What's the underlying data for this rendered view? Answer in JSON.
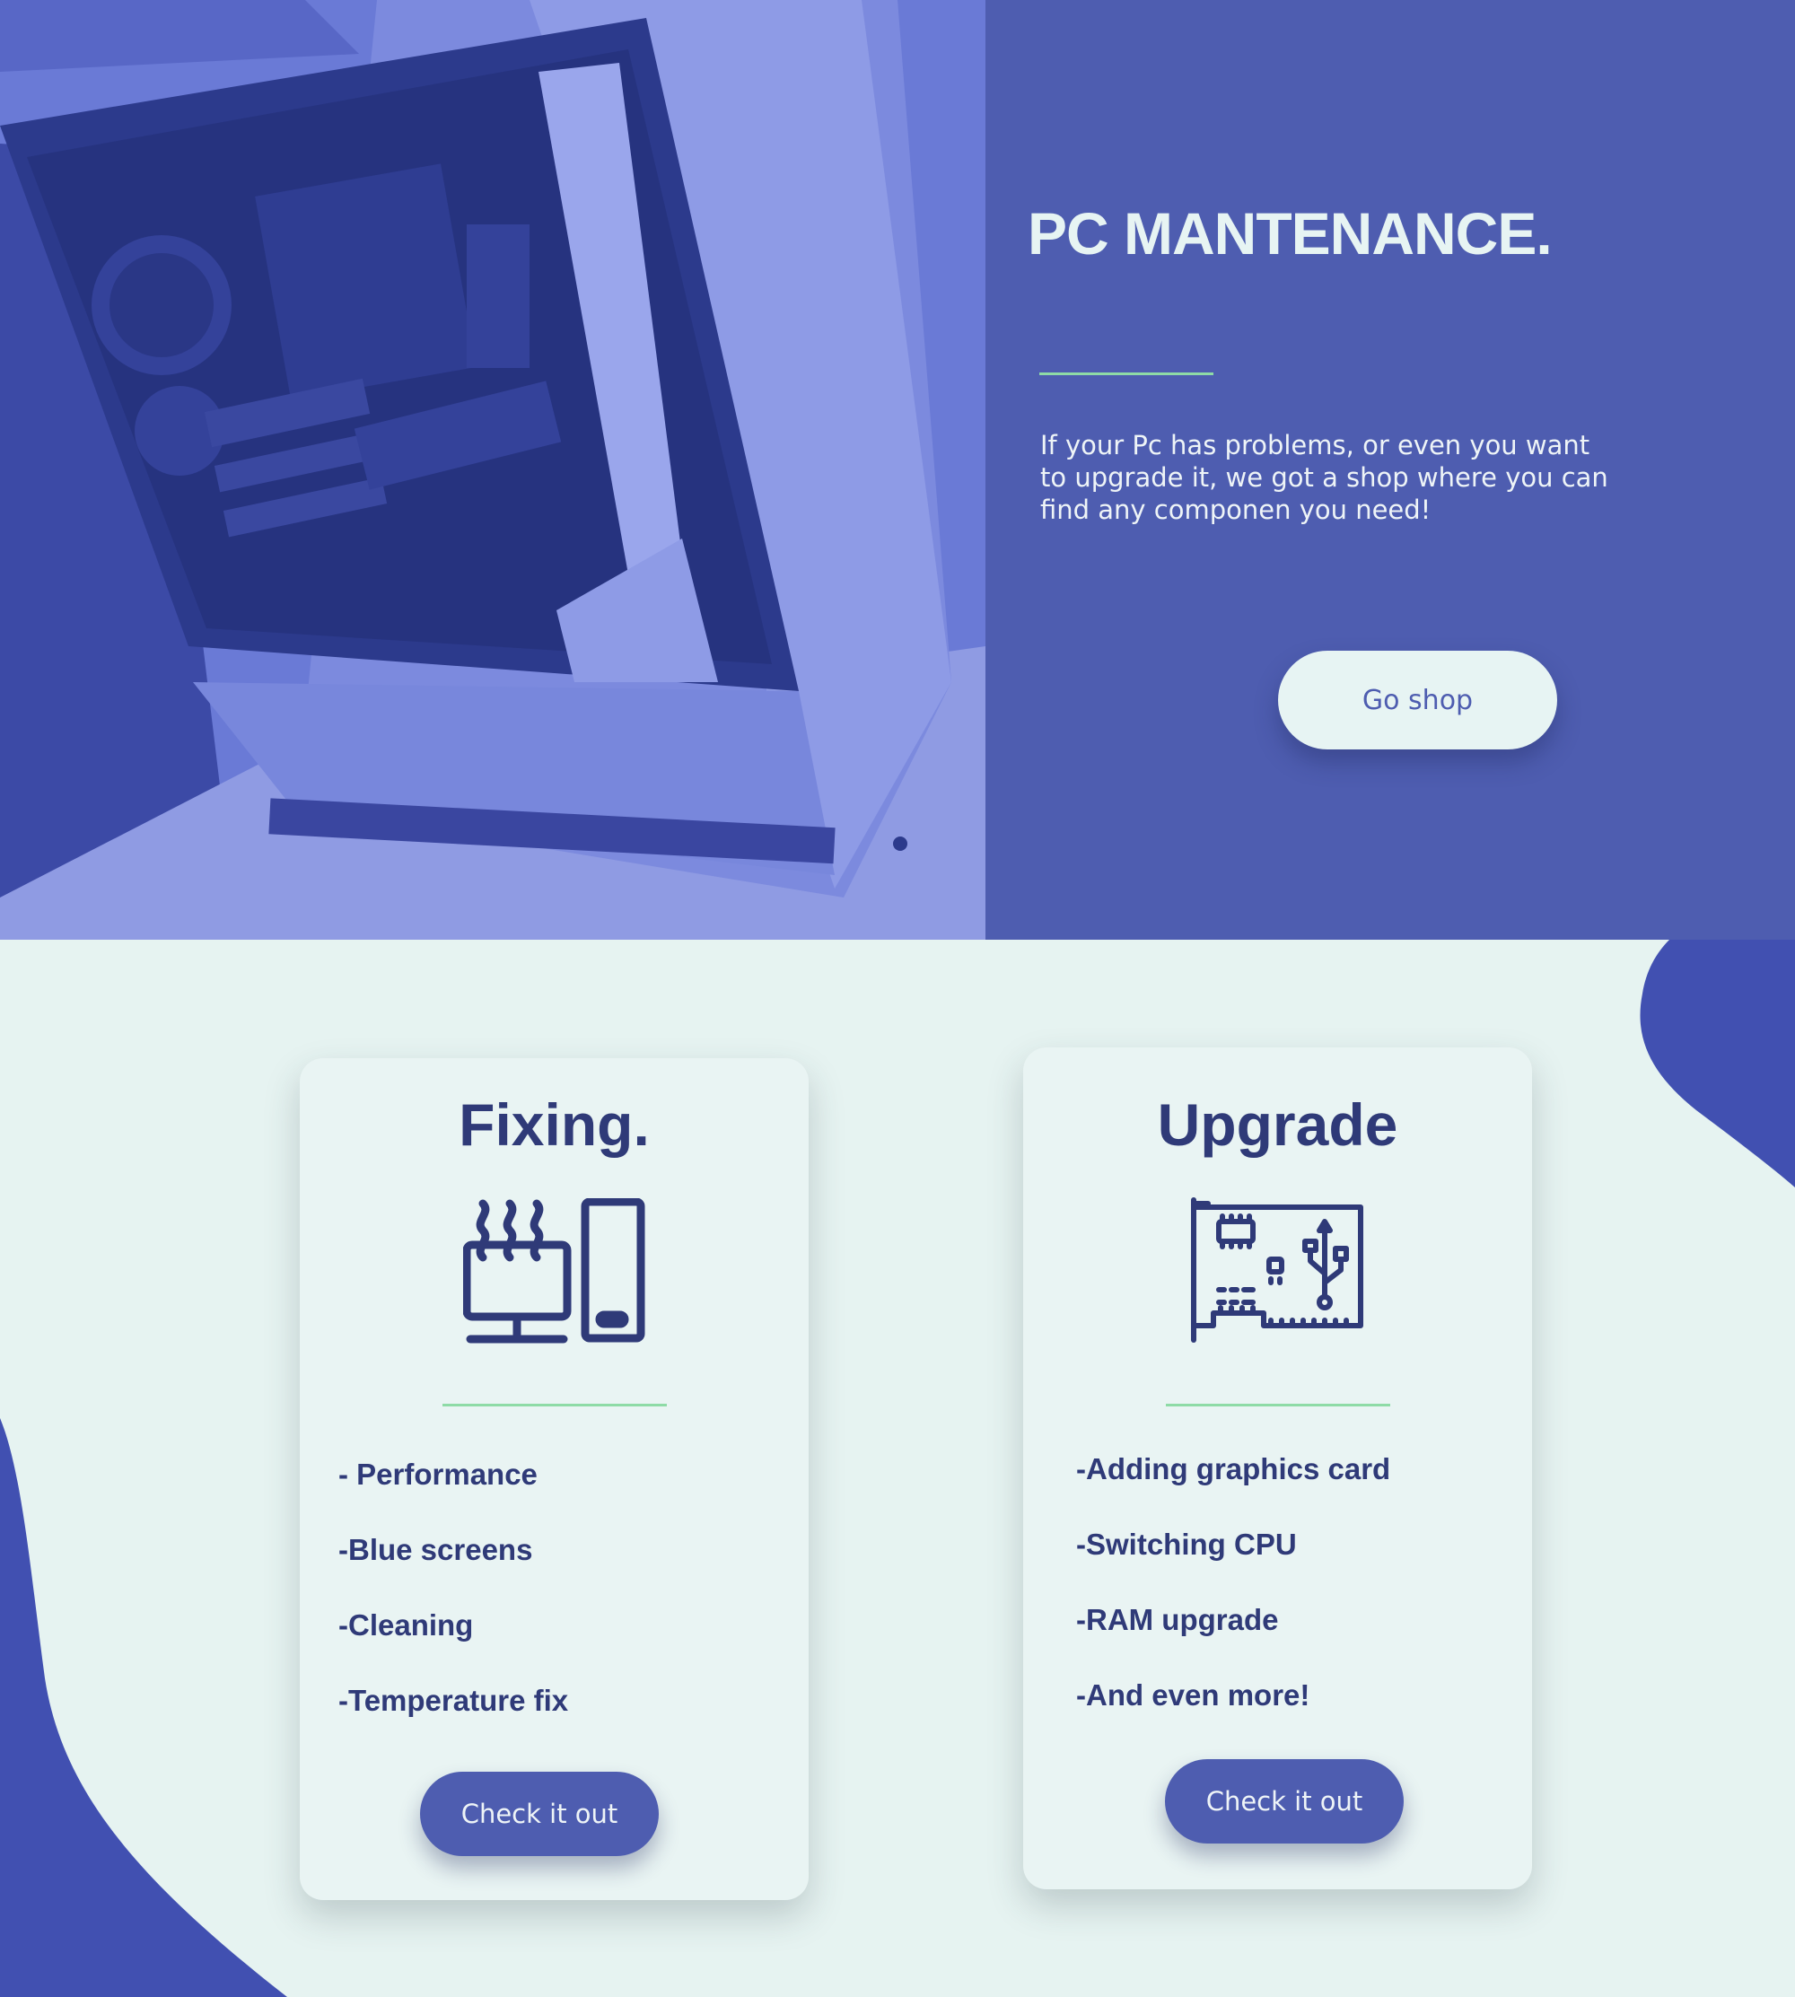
{
  "hero": {
    "title": "PC MANTENANCE.",
    "description": "If your Pc has problems, or even you want to upgrade it, we got a shop where you can find any componen you need!",
    "cta_label": "Go shop",
    "photo_icon": "pc-case-photo"
  },
  "cards": [
    {
      "title": "Fixing.",
      "icon": "overheating-computer-icon",
      "items": [
        "- Performance",
        "-Blue screens",
        "-Cleaning",
        "-Temperature fix"
      ],
      "button_label": "Check it out"
    },
    {
      "title": "Upgrade",
      "icon": "motherboard-icon",
      "items": [
        "-Adding graphics card",
        "-Switching CPU",
        "-RAM upgrade",
        "-And even more!"
      ],
      "button_label": "Check it out"
    }
  ],
  "colors": {
    "primary": "#4e5db0",
    "dark_text": "#2f3a78",
    "background": "#e6f3f1",
    "accent_line": "#8edba6",
    "blob": "#4150b1"
  }
}
